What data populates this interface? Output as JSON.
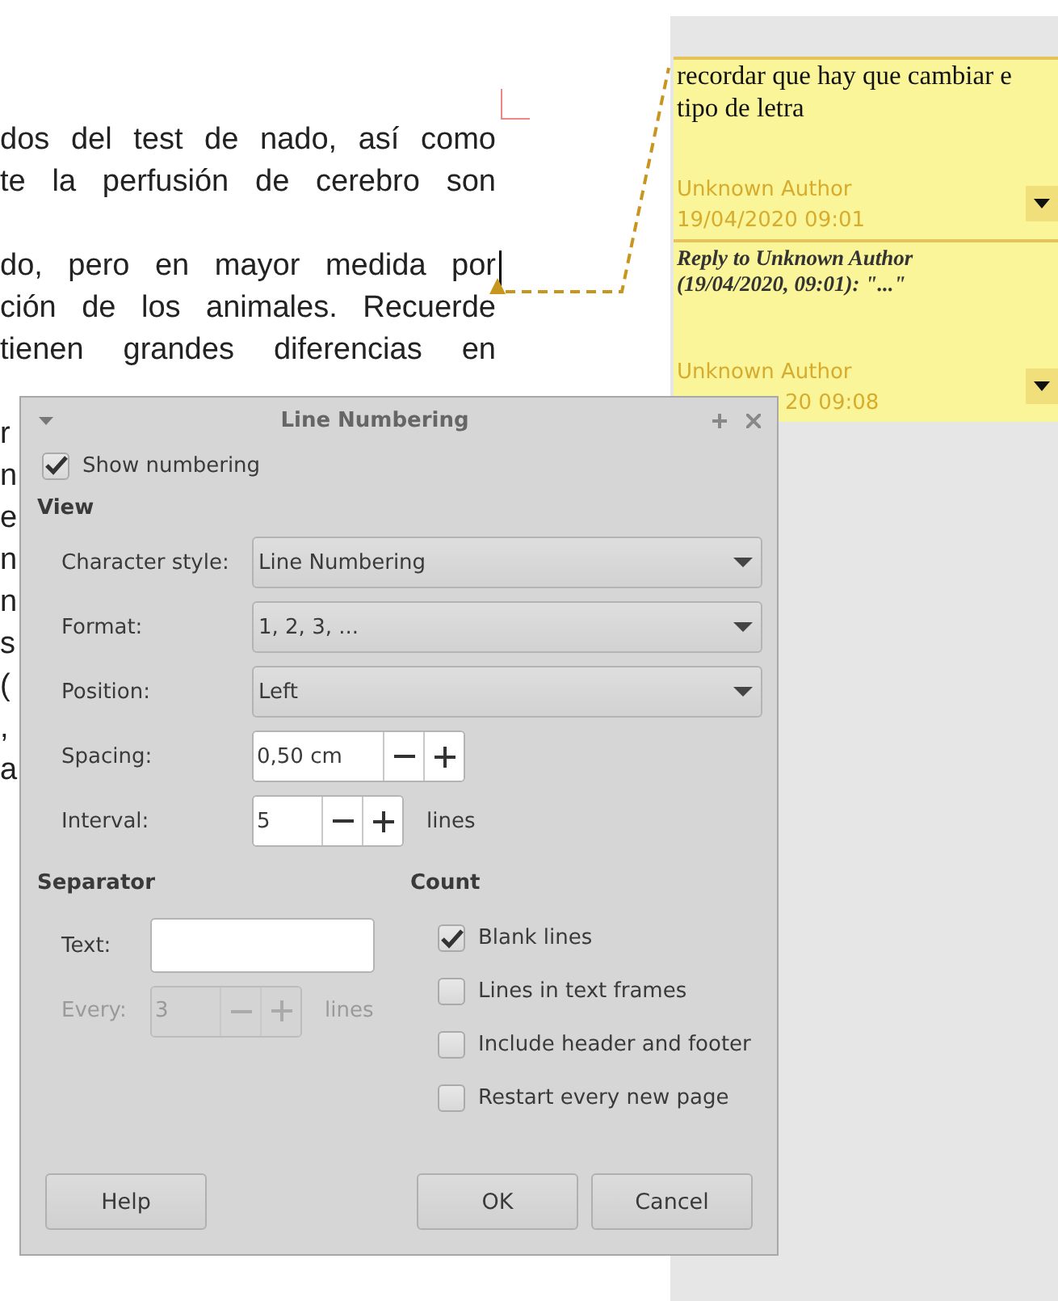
{
  "document": {
    "paragraphs": [
      {
        "lines": [
          {
            "text": "dos del test de nado, así como",
            "kind": "justified"
          },
          {
            "text": "te la perfusión de cerebro son",
            "kind": "justified"
          }
        ]
      },
      {
        "lines": [
          {
            "text": "do, pero en mayor medida por",
            "kind": "justified"
          },
          {
            "text": "ción de los animales. Recuerde",
            "kind": "justified"
          },
          {
            "text": "tienen grandes diferencias en",
            "kind": "justified"
          }
        ]
      },
      {
        "lines": [
          {
            "text": "r",
            "kind": "fragment"
          },
          {
            "text": "n",
            "kind": "fragment"
          },
          {
            "text": "e",
            "kind": "fragment"
          },
          {
            "text": "n",
            "kind": "fragment"
          },
          {
            "text": "n",
            "kind": "fragment"
          },
          {
            "text": "s",
            "kind": "fragment"
          },
          {
            "text": "(",
            "kind": "fragment"
          },
          {
            "text": ",",
            "kind": "fragment"
          },
          {
            "text": "a",
            "kind": "fragment"
          }
        ]
      }
    ]
  },
  "comments": [
    {
      "kind": "note",
      "lines": [
        "recordar que hay que cambiar e",
        "tipo de letra"
      ],
      "author": "Unknown Author",
      "date": "19/04/2020 09:01"
    },
    {
      "kind": "reply",
      "lines": [
        "Reply to Unknown Author",
        "(19/04/2020, 09:01): \"...\""
      ],
      "author": "Unknown Author",
      "date": "20 09:08"
    }
  ],
  "dialog": {
    "title": "Line Numbering",
    "show_numbering": {
      "label": "Show numbering",
      "checked": true
    },
    "view": {
      "heading": "View",
      "rows": [
        {
          "kind": "dropdown",
          "label": "Character style:",
          "value": "Line Numbering"
        },
        {
          "kind": "dropdown",
          "label": "Format:",
          "value": "1, 2, 3, ..."
        },
        {
          "kind": "dropdown",
          "label": "Position:",
          "value": "Left"
        },
        {
          "kind": "spin",
          "label": "Spacing:",
          "value": "0,50 cm",
          "disabled": false
        },
        {
          "kind": "spin",
          "label": "Interval:",
          "value": "5",
          "unit": "lines",
          "disabled": false
        }
      ]
    },
    "separator": {
      "heading": "Separator",
      "rows": [
        {
          "kind": "text",
          "label": "Text:",
          "disabled": false
        },
        {
          "kind": "spin",
          "label": "Every:",
          "value": "3",
          "unit": "lines",
          "disabled": true
        }
      ]
    },
    "count": {
      "heading": "Count",
      "options": [
        {
          "label": "Blank lines",
          "checked": true
        },
        {
          "label": "Lines in text frames",
          "checked": false
        },
        {
          "label": "Include header and footer",
          "checked": false
        },
        {
          "label": "Restart every new page",
          "checked": false
        }
      ]
    },
    "buttons": [
      {
        "label": "Help"
      },
      {
        "label": "OK"
      },
      {
        "label": "Cancel"
      }
    ]
  }
}
